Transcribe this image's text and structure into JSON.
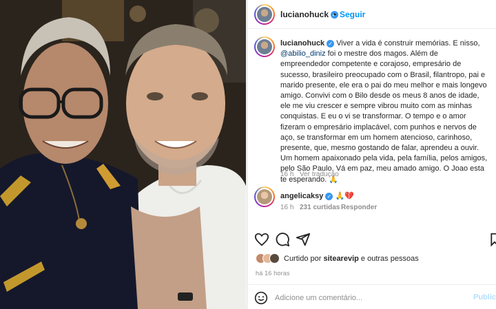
{
  "post": {
    "username": "lucianohuck",
    "follow_label": "Seguir",
    "caption": "Viver a vida é construir memórias. E nisso,",
    "mention": "@abilio_diniz",
    "caption_rest": " foi o mestre dos magos. Além de empreendedor competente e corajoso, empresário de sucesso, brasileiro preocupado com o Brasil, filantropo, pai e marido presente, ele era o pai do meu melhor e mais longevo amigo. Convivi com o Bilo desde os meus 8 anos de idade, ele me viu crescer e sempre vibrou muito com as minhas conquistas. E eu o vi se transformar. O tempo e o amor fizeram o empresário implacável, com punhos e nervos de aço, se transformar em um homem atencioso, carinhoso, presente, que, mesmo gostando de falar, aprendeu a ouvir. Um homem apaixonado pela vida, pela família, pelos amigos, pelo São Paulo. Vá em paz, meu amado amigo. O Joao esta te esperando. 🙏",
    "caption_time": "16 h",
    "translation_label": "Ver tradução"
  },
  "comment": {
    "username": "angelicaksy",
    "text": "🙏💔",
    "time": "16 h",
    "likes": "231 curtidas",
    "reply_label": "Responder"
  },
  "actions": {
    "like_icon": "heart-icon",
    "comment_icon": "comment-icon",
    "share_icon": "share-icon",
    "save_icon": "bookmark-icon"
  },
  "liked_by": {
    "prefix": "Curtido por",
    "user": "sitearevip",
    "suffix": "e outras pessoas"
  },
  "timestamp": "há 16 horas",
  "add_comment": {
    "placeholder": "Adicione um comentário...",
    "publish_label": "Publicar"
  },
  "colors": {
    "accent": "#0095f6",
    "verified": "#3897f0",
    "mention": "#00376b",
    "muted": "#8e8e8e"
  }
}
